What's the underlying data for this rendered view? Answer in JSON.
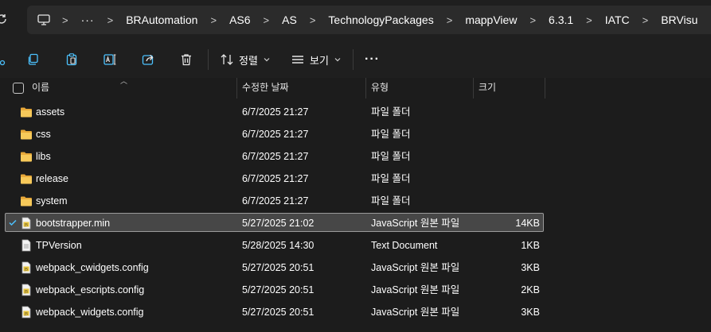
{
  "address": {
    "crumbs": [
      "BRAutomation",
      "AS6",
      "AS",
      "TechnologyPackages",
      "mappView",
      "6.3.1",
      "IATC",
      "BRVisu"
    ],
    "more": "···",
    "separator": ">"
  },
  "toolbar": {
    "sort_label": "정렬",
    "view_label": "보기",
    "more_label": "···"
  },
  "columns": {
    "name": "이름",
    "modified": "수정한 날짜",
    "type": "유형",
    "size": "크기"
  },
  "files": [
    {
      "name": "assets",
      "modified": "6/7/2025 21:27",
      "type": "파일 폴더",
      "size": "",
      "icon": "folder-icon",
      "selected": false
    },
    {
      "name": "css",
      "modified": "6/7/2025 21:27",
      "type": "파일 폴더",
      "size": "",
      "icon": "folder-icon",
      "selected": false
    },
    {
      "name": "libs",
      "modified": "6/7/2025 21:27",
      "type": "파일 폴더",
      "size": "",
      "icon": "folder-icon",
      "selected": false
    },
    {
      "name": "release",
      "modified": "6/7/2025 21:27",
      "type": "파일 폴더",
      "size": "",
      "icon": "folder-icon",
      "selected": false
    },
    {
      "name": "system",
      "modified": "6/7/2025 21:27",
      "type": "파일 폴더",
      "size": "",
      "icon": "folder-icon",
      "selected": false
    },
    {
      "name": "bootstrapper.min",
      "modified": "5/27/2025 21:02",
      "type": "JavaScript 원본 파일",
      "size": "14KB",
      "icon": "js-file-icon",
      "selected": true
    },
    {
      "name": "TPVersion",
      "modified": "5/28/2025 14:30",
      "type": "Text Document",
      "size": "1KB",
      "icon": "text-file-icon",
      "selected": false
    },
    {
      "name": "webpack_cwidgets.config",
      "modified": "5/27/2025 20:51",
      "type": "JavaScript 원본 파일",
      "size": "3KB",
      "icon": "js-file-icon",
      "selected": false
    },
    {
      "name": "webpack_escripts.config",
      "modified": "5/27/2025 20:51",
      "type": "JavaScript 원본 파일",
      "size": "2KB",
      "icon": "js-file-icon",
      "selected": false
    },
    {
      "name": "webpack_widgets.config",
      "modified": "5/27/2025 20:51",
      "type": "JavaScript 원본 파일",
      "size": "3KB",
      "icon": "js-file-icon",
      "selected": false
    }
  ],
  "colors": {
    "accent": "#4cc2ff",
    "folder": "#f5c04a",
    "selection": "#474747"
  }
}
